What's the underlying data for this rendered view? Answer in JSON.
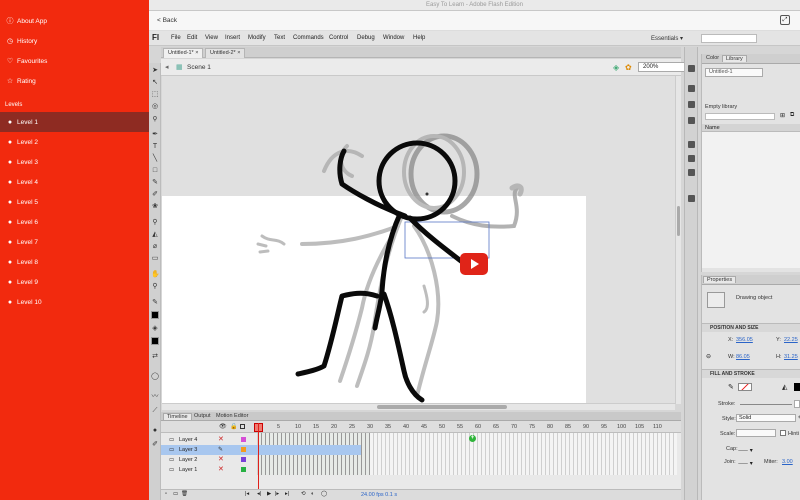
{
  "sidebar": {
    "top_items": [
      {
        "icon": "info-icon",
        "label": "About App"
      },
      {
        "icon": "clock-icon",
        "label": "History"
      },
      {
        "icon": "heart-icon",
        "label": "Favourites"
      },
      {
        "icon": "star-icon",
        "label": "Rating"
      }
    ],
    "section_label": "Levels",
    "levels": [
      "Level 1",
      "Level 2",
      "Level 3",
      "Level 4",
      "Level 5",
      "Level 6",
      "Level 7",
      "Level 8",
      "Level 9",
      "Level 10"
    ],
    "active_level": 0,
    "accent": "#f22a0e",
    "active_bg": "#8e2b22"
  },
  "window": {
    "title": "Easy To Learn - Adobe Flash Edition",
    "back_label": "< Back"
  },
  "flash": {
    "logo": "Fl",
    "menu": [
      "File",
      "Edit",
      "View",
      "Insert",
      "Modify",
      "Text",
      "Commands",
      "Control",
      "Debug",
      "Window",
      "Help"
    ],
    "workspace": "Essentials ▾",
    "doc_tabs": [
      "Untitled-1*",
      "Untitled-2*"
    ],
    "scene": "Scene 1",
    "zoom": "200%",
    "timeline_tabs": [
      "Timeline",
      "Output",
      "Motion Editor"
    ],
    "frame_numbers": [
      "5",
      "10",
      "15",
      "20",
      "25",
      "30",
      "35",
      "40",
      "45",
      "50",
      "55",
      "60",
      "65",
      "70",
      "75",
      "80",
      "85",
      "90",
      "95",
      "100",
      "105",
      "110"
    ],
    "layers": [
      {
        "name": "Layer 4",
        "color": "#d64fd6",
        "selected": false
      },
      {
        "name": "Layer 3",
        "color": "#f39a1d",
        "selected": true
      },
      {
        "name": "Layer 2",
        "color": "#7a3fd8",
        "selected": false
      },
      {
        "name": "Layer 1",
        "color": "#27b043",
        "selected": false
      }
    ],
    "timeline_footer": "24.00 fps   0.1 s"
  },
  "library": {
    "tabs": [
      "Color",
      "Library"
    ],
    "document": "Untitled-1",
    "empty_label": "Empty library",
    "column": "Name"
  },
  "properties": {
    "tab": "Properties",
    "type": "Drawing object",
    "sections": {
      "position": "POSITION AND SIZE",
      "fill": "FILL AND STROKE"
    },
    "x_label": "X:",
    "x_value": "356.05",
    "y_label": "Y:",
    "y_value": "22.25",
    "w_label": "W:",
    "w_value": "86.05",
    "h_label": "H:",
    "h_value": "31.25",
    "stroke_label": "Stroke:",
    "style_label": "Style:",
    "style_value": "Solid",
    "scale_label": "Scale:",
    "hinting_label": "Hinti",
    "cap_label": "Cap:",
    "join_label": "Join:",
    "miter_label": "Miter:",
    "miter_value": "3.00"
  }
}
